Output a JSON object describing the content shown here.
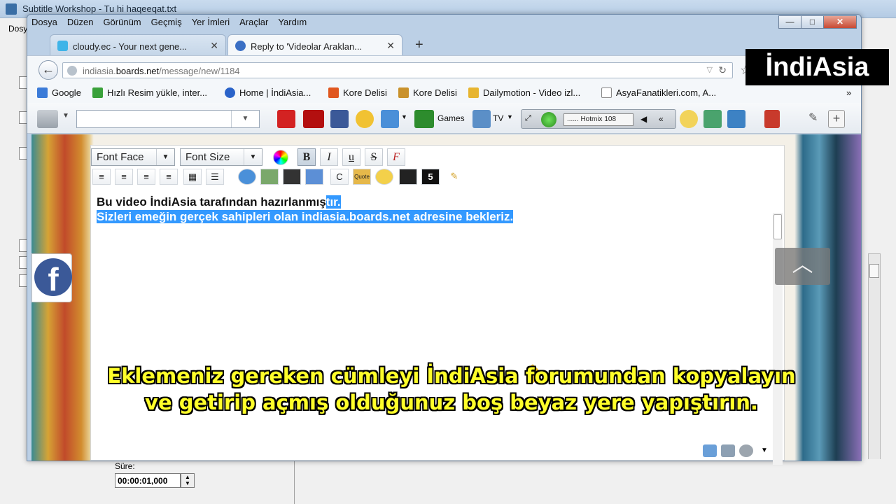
{
  "background_app": {
    "title": "Subtitle Workshop - Tu hi haqeeqat.txt",
    "menu_first": "Dosya",
    "duration_label": "Süre:",
    "duration_value": "00:00:01,000"
  },
  "browser": {
    "menu": [
      "Dosya",
      "Düzen",
      "Görünüm",
      "Geçmiş",
      "Yer İmleri",
      "Araçlar",
      "Yardım"
    ],
    "tabs": [
      {
        "title": "cloudy.ec - Your next gene..."
      },
      {
        "title": "Reply to 'Videolar Araklan..."
      }
    ],
    "new_tab": "+",
    "url": {
      "domain_pre": "indiasia.",
      "domain_main": "boards.net",
      "path": "/message/new/1184"
    },
    "bookmarks": [
      {
        "label": "Google",
        "color": "#3b7bd8"
      },
      {
        "label": "Hızlı Resim yükle, inter...",
        "color": "#3aa13a"
      },
      {
        "label": "Home | İndiAsia...",
        "color": "#2a63c9"
      },
      {
        "label": "Kore Delisi",
        "color": "#e0571f"
      },
      {
        "label": "Kore Delisi",
        "color": "#c9922c"
      },
      {
        "label": "Dailymotion - Video izl...",
        "color": "#e7b530"
      },
      {
        "label": "AsyaFanatikleri.com, A...",
        "color": "#ffffff"
      }
    ],
    "bookmarks_more": "»",
    "toolbar": {
      "games_label": "Games",
      "tv_label": "TV",
      "radio_station": "...... Hotmix 108"
    }
  },
  "editor": {
    "font_face": "Font Face",
    "font_size": "Font Size",
    "bold": "B",
    "italic": "I",
    "underline": "u",
    "strike": "S",
    "clear": "F",
    "line1_normal": "Bu video İndiAsia tarafından hazırlanmış",
    "line1_selected": "tır.",
    "line2_selected": "Sizleri emeğin gerçek sahipleri olan indiasia.boards.net adresine bekleriz."
  },
  "overlays": {
    "watermark": "İndiAsia",
    "subtitle_line1": "Eklemeniz gereken cümleyi İndiAsia forumundan kopyalayın",
    "subtitle_line2": "ve getirip açmış olduğunuz boş beyaz yere yapıştırın."
  },
  "colors": {
    "selection": "#3399ff",
    "subtitle_text": "#ffff2a",
    "facebook": "#3b5998"
  }
}
